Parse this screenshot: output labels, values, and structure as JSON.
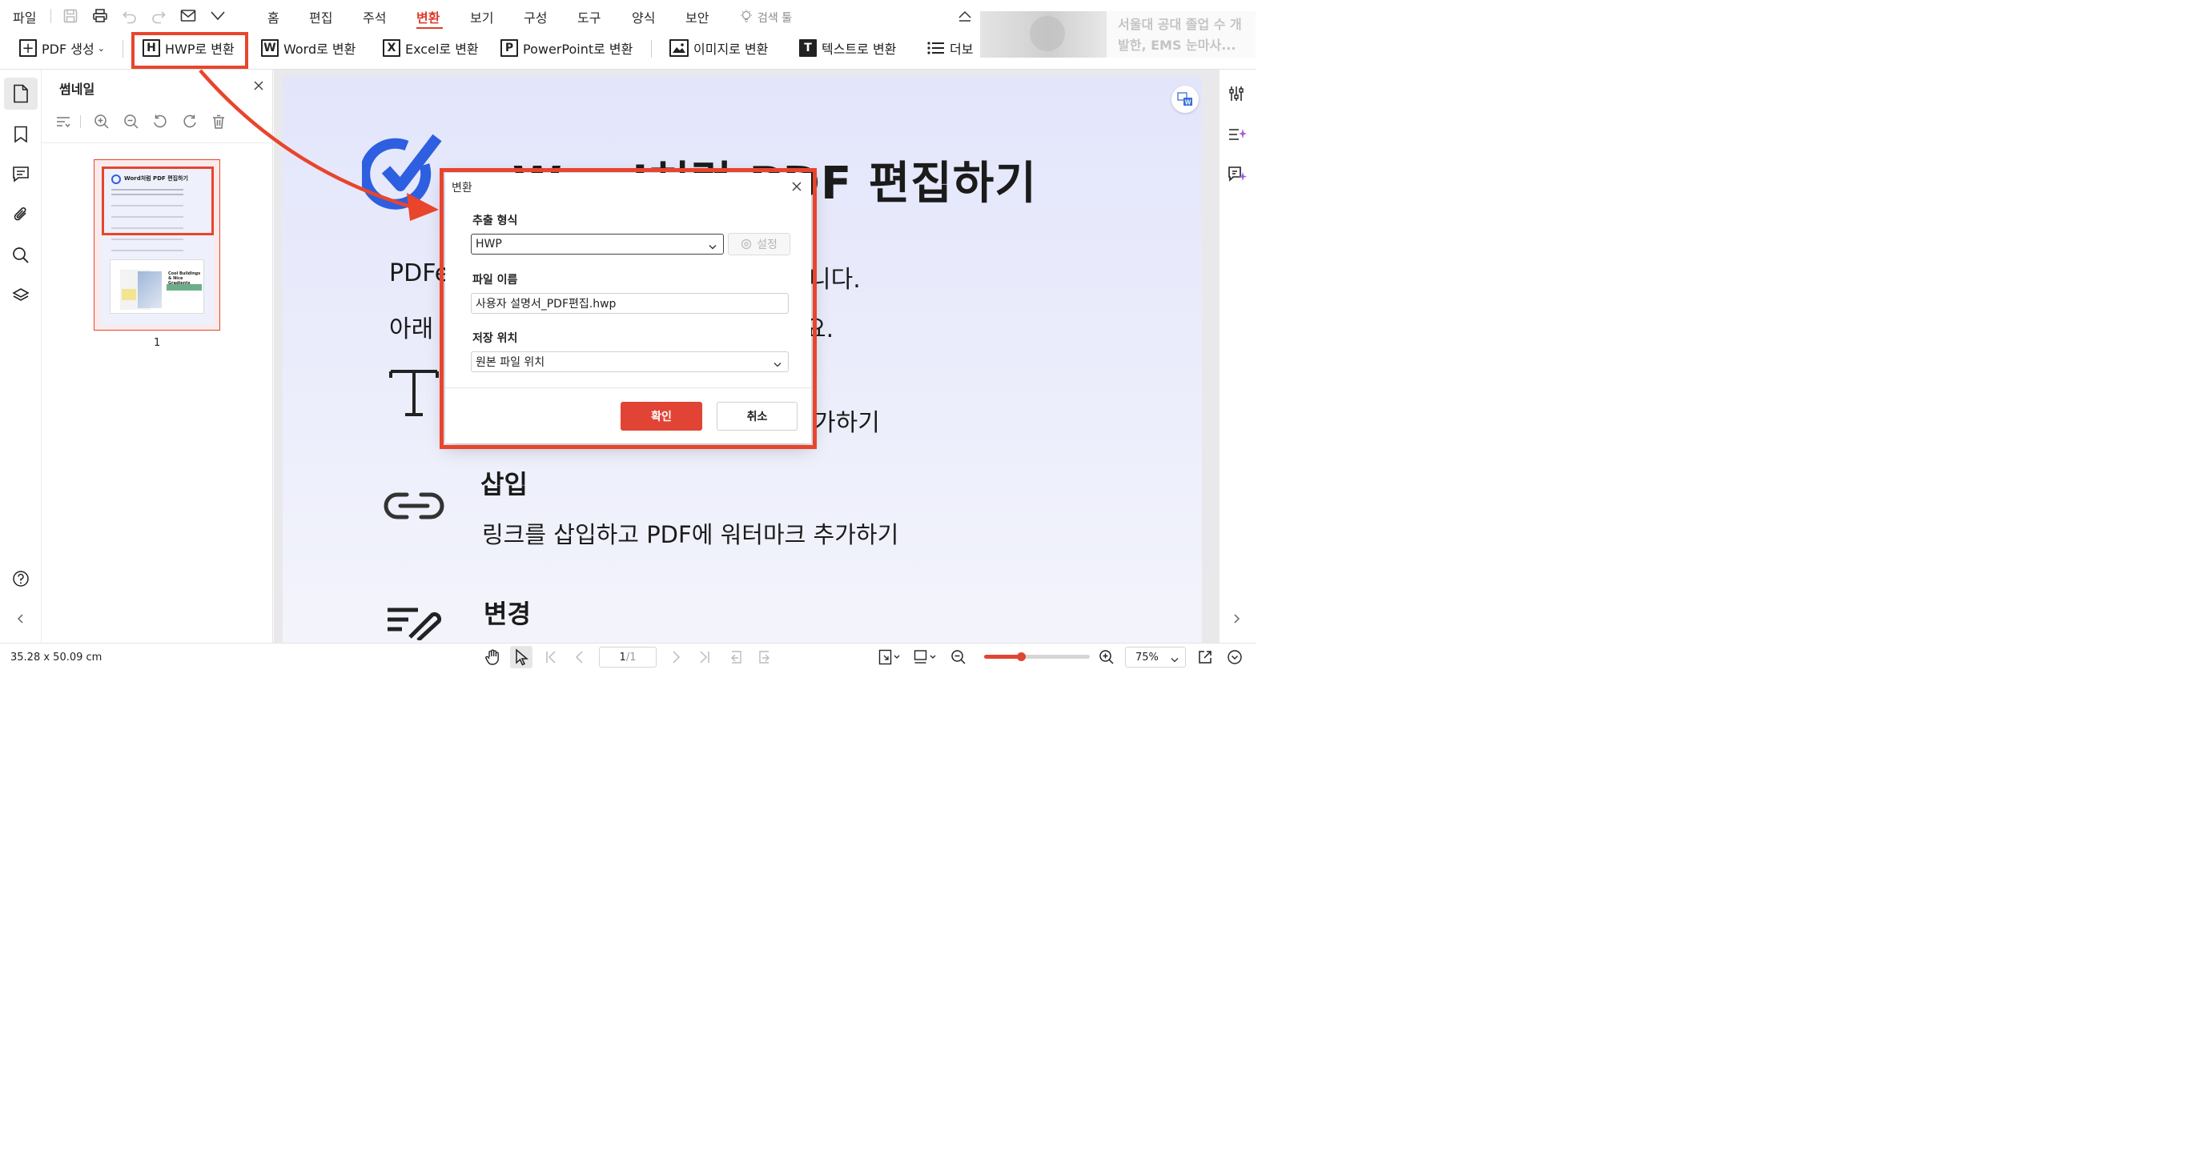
{
  "topbar": {
    "file_menu": "파일",
    "tabs": [
      "홈",
      "편집",
      "주석",
      "변환",
      "보기",
      "구성",
      "도구",
      "양식",
      "보안"
    ],
    "active_tab": "변환",
    "search_label": "검색 툴"
  },
  "ad": {
    "line1": "서울대 공대 졸업 수 개",
    "line2": "발한, EMS 눈마사..."
  },
  "toolbar": {
    "pdf_create": "PDF 생성",
    "to_hwp": "HWP로 변환",
    "to_word": "Word로 변환",
    "to_excel": "Excel로 변환",
    "to_ppt": "PowerPoint로 변환",
    "to_image": "이미지로 변환",
    "to_text": "텍스트로 변환",
    "more": "더보"
  },
  "thumbnail_panel": {
    "title": "썸네일",
    "page_number": "1",
    "mini_title": "Word처럼 PDF 편집하기",
    "mini_card": "Cool Buildings & Nice Gradients"
  },
  "document": {
    "title": "Word처럼 PDF 편집하기",
    "line1_start": "PDFe",
    "line1_end": "니다.",
    "line2_start": "아래",
    "line2_end": "요.",
    "item_add_tail": "가하기",
    "item_insert_title": "삽입",
    "item_insert_desc": "링크를 삽입하고 PDF에 워터마크 추가하기",
    "item_change_title": "변경"
  },
  "dialog": {
    "title": "변환",
    "format_label": "추출 형식",
    "format_value": "HWP",
    "settings_button": "설정",
    "filename_label": "파일 이름",
    "filename_value": "사용자 설명서_PDF편집.hwp",
    "location_label": "저장 위치",
    "location_value": "원본 파일 위치",
    "ok": "확인",
    "cancel": "취소"
  },
  "statusbar": {
    "size": "35.28 x 50.09 cm",
    "page_current": "1",
    "page_total": "/1",
    "zoom": "75%",
    "zoom_level": 0.35
  },
  "colors": {
    "accent": "#e8452c",
    "confirm": "#e14434",
    "active_tab": "#e03c2d",
    "check_blue": "#2d5fe0",
    "page_bg": "#e6e8fb"
  }
}
